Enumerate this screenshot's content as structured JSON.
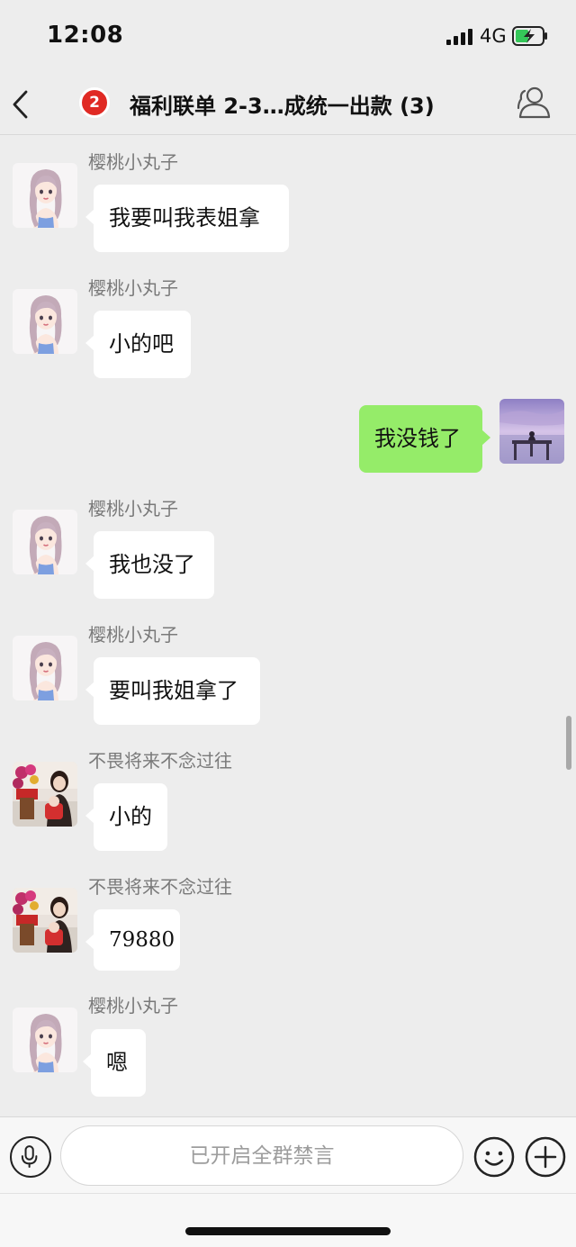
{
  "status_bar": {
    "time": "12:08",
    "network": "4G"
  },
  "header": {
    "badge": "2",
    "title": "福利联单 2-3…成统一出款 (3)"
  },
  "messages": [
    {
      "sender": "樱桃小丸子",
      "text": "我要叫我表姐拿"
    },
    {
      "sender": "樱桃小丸子",
      "text": "小的吧"
    },
    {
      "sender": "me",
      "text": "我没钱了"
    },
    {
      "sender": "樱桃小丸子",
      "text": "我也没了"
    },
    {
      "sender": "樱桃小丸子",
      "text": "要叫我姐拿了"
    },
    {
      "sender": "不畏将来不念过往",
      "text": "小的"
    },
    {
      "sender": "不畏将来不念过往",
      "text": "79880"
    },
    {
      "sender": "樱桃小丸子",
      "text": "嗯"
    }
  ],
  "input_bar": {
    "muted_notice": "已开启全群禁言"
  },
  "colors": {
    "sent_bubble": "#95ec69",
    "badge": "#e02a24",
    "background": "#ededed"
  }
}
